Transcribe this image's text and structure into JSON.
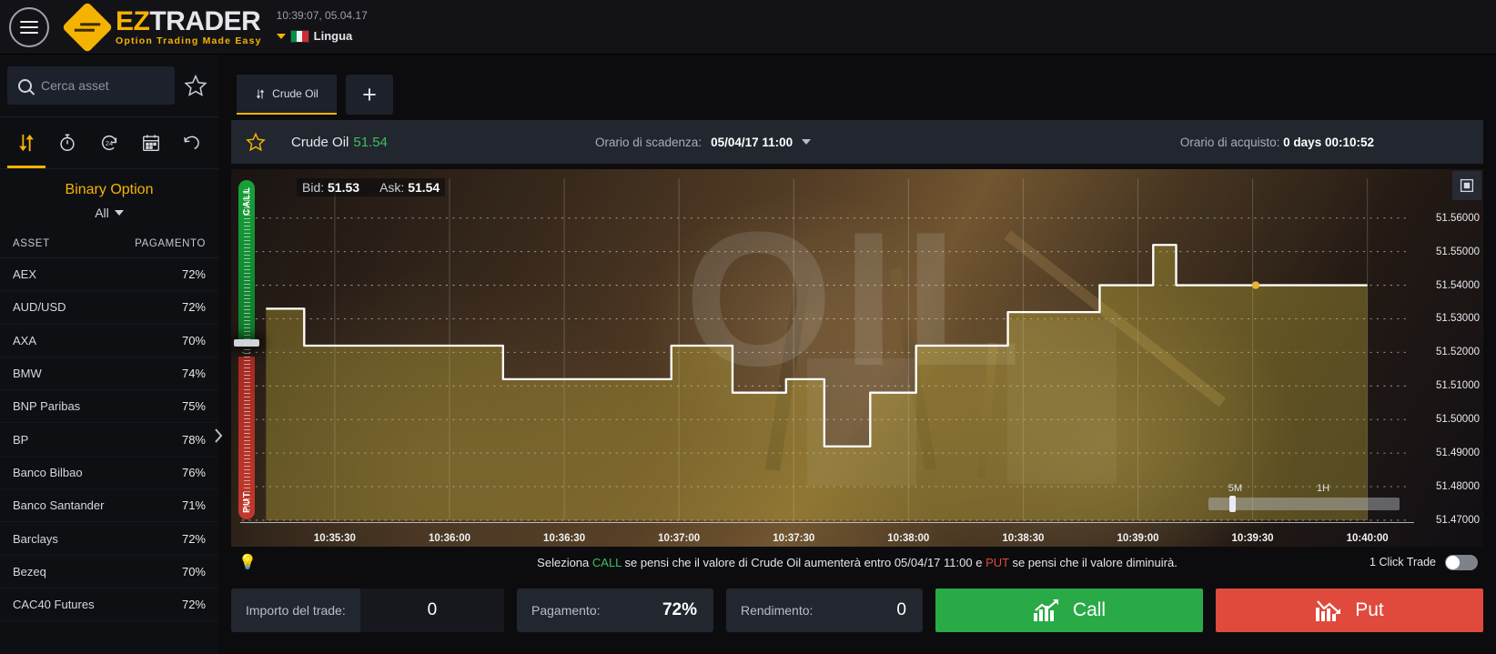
{
  "header": {
    "menu_icon": "hamburger-icon",
    "logo_ez": "EZ",
    "logo_trader": "TRADER",
    "logo_tagline": "Option Trading Made Easy",
    "clock": "10:39:07, 05.04.17",
    "language_label": "Lingua",
    "flag": "italy-flag"
  },
  "sidebar": {
    "search_placeholder": "Cerca asset",
    "search_value": "",
    "favorites_icon": "star-icon",
    "tool_tabs": [
      {
        "name": "binary-option",
        "icon": "updown-arrows-icon",
        "active": true
      },
      {
        "name": "short-term",
        "icon": "stopwatch-icon",
        "active": false
      },
      {
        "name": "option-plus",
        "icon": "clock-24-icon",
        "active": false
      },
      {
        "name": "long-term",
        "icon": "calendar-icon",
        "active": false
      },
      {
        "name": "history",
        "icon": "undo-icon",
        "active": false
      }
    ],
    "option_title": "Binary Option",
    "filter_label": "All",
    "col_asset": "ASSET",
    "col_payout": "PAGAMENTO",
    "assets": [
      {
        "name": "AEX",
        "payout": "72%"
      },
      {
        "name": "AUD/USD",
        "payout": "72%"
      },
      {
        "name": "AXA",
        "payout": "70%"
      },
      {
        "name": "BMW",
        "payout": "74%"
      },
      {
        "name": "BNP Paribas",
        "payout": "75%"
      },
      {
        "name": "BP",
        "payout": "78%"
      },
      {
        "name": "Banco Bilbao",
        "payout": "76%"
      },
      {
        "name": "Banco Santander",
        "payout": "71%"
      },
      {
        "name": "Barclays",
        "payout": "72%"
      },
      {
        "name": "Bezeq",
        "payout": "70%"
      },
      {
        "name": "CAC40 Futures",
        "payout": "72%"
      }
    ],
    "collapse_icon": "chevron-right-icon"
  },
  "tabs": {
    "items": [
      {
        "label": "Crude Oil",
        "icon": "updown-arrows-icon",
        "active": true
      }
    ],
    "add_label": "+"
  },
  "asset_bar": {
    "star_icon": "star-icon",
    "asset_name": "Crude Oil",
    "price": "51.54",
    "expiry_label": "Orario di scadenza:",
    "expiry_value": "05/04/17 11:00",
    "purchase_label": "Orario di acquisto:",
    "purchase_value": "0 days 00:10:52"
  },
  "chart": {
    "bid_label": "Bid:",
    "bid_value": "51.53",
    "ask_label": "Ask:",
    "ask_value": "51.54",
    "expand_icon": "fullscreen-icon",
    "call_label": "CALL",
    "put_label": "PUT",
    "watermark": "OIL",
    "timeframe_short": "5M",
    "timeframe_long": "1H"
  },
  "chart_data": {
    "type": "line",
    "title": "Crude Oil",
    "xlabel": "",
    "ylabel": "",
    "ylim": [
      51.47,
      51.565
    ],
    "xlim": [
      "10:35:10",
      "10:40:10"
    ],
    "grid": true,
    "legend": "none",
    "y_ticks": [
      "51.56000",
      "51.55000",
      "51.54000",
      "51.53000",
      "51.52000",
      "51.51000",
      "51.50000",
      "51.49000",
      "51.48000",
      "51.47000"
    ],
    "x_ticks": [
      "10:35:30",
      "10:36:00",
      "10:36:30",
      "10:37:00",
      "10:37:30",
      "10:38:00",
      "10:38:30",
      "10:39:00",
      "10:39:30",
      "10:40:00"
    ],
    "series": [
      {
        "name": "Crude Oil price",
        "line_color": "#ffffff",
        "fill_color": "rgba(200,180,60,0.35)",
        "x": [
          "10:35:12",
          "10:35:16",
          "10:35:22",
          "10:35:38",
          "10:36:10",
          "10:36:14",
          "10:36:54",
          "10:36:58",
          "10:37:10",
          "10:37:14",
          "10:37:24",
          "10:37:28",
          "10:37:34",
          "10:37:38",
          "10:37:46",
          "10:37:50",
          "10:37:58",
          "10:38:02",
          "10:38:22",
          "10:38:26",
          "10:38:46",
          "10:38:50",
          "10:39:00",
          "10:39:04",
          "10:39:10",
          "10:40:00"
        ],
        "y": [
          51.533,
          51.533,
          51.522,
          51.522,
          51.522,
          51.512,
          51.512,
          51.522,
          51.522,
          51.508,
          51.508,
          51.512,
          51.512,
          51.492,
          51.492,
          51.508,
          51.508,
          51.522,
          51.522,
          51.532,
          51.532,
          51.54,
          51.54,
          51.552,
          51.54,
          51.54
        ]
      }
    ],
    "current_point": {
      "x": "10:39:10",
      "y": 51.54,
      "color": "#e8b33a"
    }
  },
  "trade_panel": {
    "hint_prefix": "Seleziona ",
    "hint_call": "CALL",
    "hint_mid": " se pensi che il valore di Crude Oil aumenterà entro 05/04/17 11:00 e ",
    "hint_put": "PUT",
    "hint_suffix": " se pensi che il valore diminuirà.",
    "bulb_icon": "lightbulb-icon",
    "one_click_label": "1 Click Trade",
    "one_click_on": false,
    "amount_label": "Importo del trade:",
    "amount_value": "0",
    "payout_label": "Pagamento:",
    "payout_value": "72%",
    "return_label": "Rendimento:",
    "return_value": "0",
    "call_button": "Call",
    "put_button": "Put",
    "call_icon": "chart-up-icon",
    "put_icon": "chart-down-icon"
  },
  "colors": {
    "accent": "#f5b301",
    "call_green": "#2aaa47",
    "put_red": "#e04a3c",
    "panel": "#22262f",
    "background": "#0c0c0e"
  }
}
